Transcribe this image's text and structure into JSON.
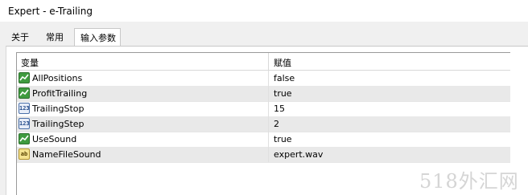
{
  "window": {
    "title": "Expert - e-Trailing"
  },
  "tabs": [
    {
      "label": "关于",
      "active": false
    },
    {
      "label": "常用",
      "active": false
    },
    {
      "label": "输入参数",
      "active": true
    }
  ],
  "table": {
    "columns": [
      "变量",
      "赋值"
    ],
    "rows": [
      {
        "icon": "bool-icon",
        "name": "AllPositions",
        "value": "false"
      },
      {
        "icon": "bool-icon",
        "name": "ProfitTrailing",
        "value": "true"
      },
      {
        "icon": "number-icon",
        "icon_text": "123",
        "name": "TrailingStop",
        "value": "15"
      },
      {
        "icon": "number-icon",
        "icon_text": "123",
        "name": "TrailingStep",
        "value": "2"
      },
      {
        "icon": "bool-icon",
        "name": "UseSound",
        "value": "true"
      },
      {
        "icon": "string-icon",
        "icon_text": "ab",
        "name": "NameFileSound",
        "value": "expert.wav"
      }
    ]
  },
  "watermark": {
    "text": "518外汇网"
  },
  "colors": {
    "bool_icon": "#3f9b3f",
    "number_icon": "#4a6fa8",
    "string_icon": "#f4e28f",
    "alt_row": "#e9e9e9"
  }
}
